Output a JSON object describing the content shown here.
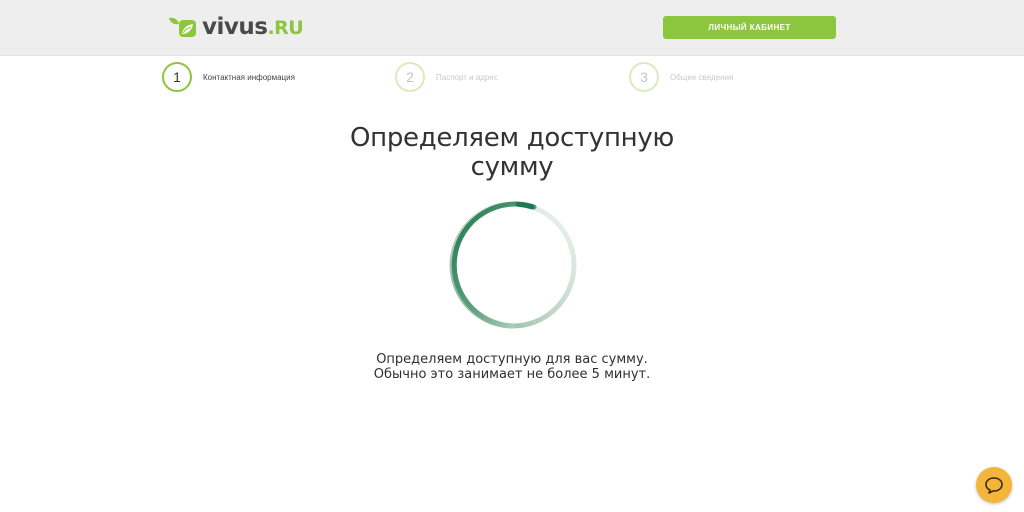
{
  "header": {
    "logo": {
      "word_main": "vivus",
      "word_suffix": ".RU",
      "mark_icon": "leaf-logo-icon"
    },
    "cabinet_button_label": "ЛИЧНЫЙ КАБИНЕТ"
  },
  "steps": [
    {
      "number": "1",
      "label": "Контактная информация",
      "state": "active"
    },
    {
      "number": "2",
      "label": "Паспорт и адрес",
      "state": "inactive"
    },
    {
      "number": "3",
      "label": "Общие сведения",
      "state": "inactive"
    }
  ],
  "main": {
    "title_line1": "Определяем доступную",
    "title_line2": "сумму",
    "status_line1": "Определяем доступную для вас сумму.",
    "status_line2": "Обычно это занимает не более 5 минут.",
    "spinner_icon": "loading-spinner-icon"
  },
  "chat": {
    "icon": "chat-bubble-icon"
  },
  "colors": {
    "brand_green": "#8cc63f",
    "spinner_dark": "#1f7a4f",
    "chat_orange": "#f3b63a",
    "header_bg": "#eeeeee"
  }
}
